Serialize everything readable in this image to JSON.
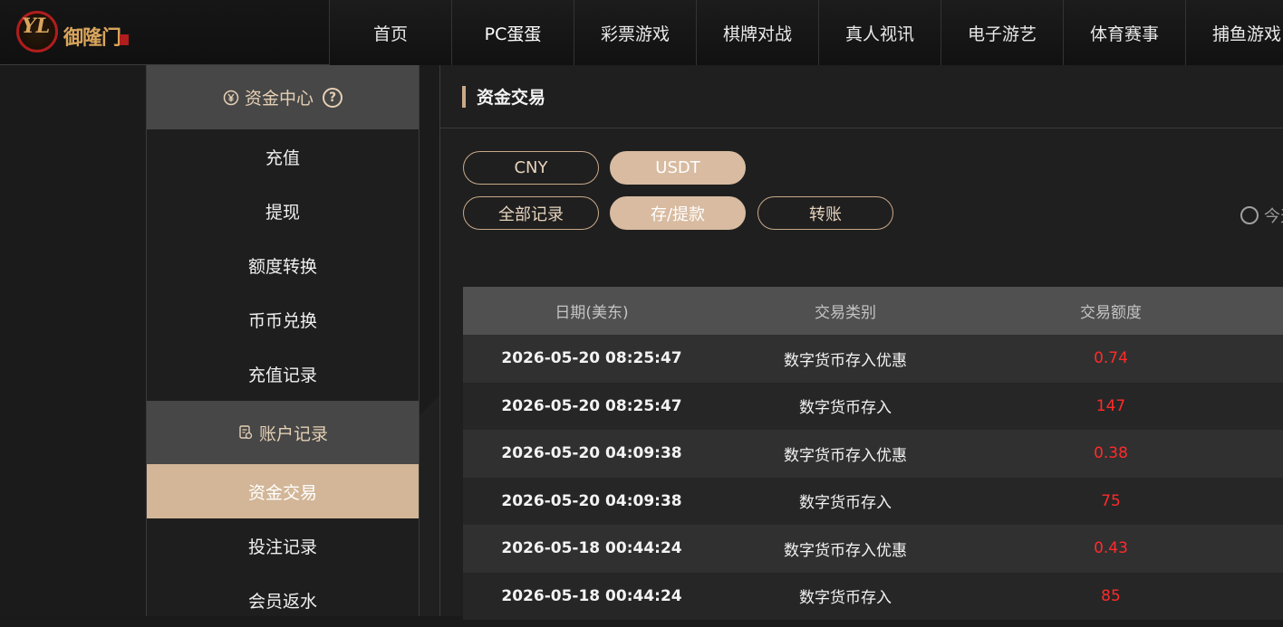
{
  "brand": {
    "logo_text": "御隆门"
  },
  "nav": {
    "items": [
      "首页",
      "PC蛋蛋",
      "彩票游戏",
      "棋牌对战",
      "真人视讯",
      "电子游艺",
      "体育赛事",
      "捕鱼游戏"
    ]
  },
  "sidebar": {
    "fund_center": "资金中心",
    "help_icon_text": "?",
    "fund_items": [
      "充值",
      "提现",
      "额度转换",
      "币币兑换",
      "充值记录"
    ],
    "account_records": "账户记录",
    "record_items": [
      "资金交易",
      "投注记录",
      "会员返水"
    ],
    "active_item": "资金交易"
  },
  "main": {
    "title": "资金交易",
    "currency_tabs": [
      "CNY",
      "USDT"
    ],
    "active_currency": "USDT",
    "record_tabs": [
      "全部记录",
      "存/提款",
      "转账"
    ],
    "active_record_tab": "存/提款",
    "date_radio_label": "今天"
  },
  "table": {
    "columns": [
      "日期(美东)",
      "交易类别",
      "交易额度"
    ],
    "rows": [
      {
        "date": "2026-05-20 08:25:47",
        "type": "数字货币存入优惠",
        "amount": "0.74"
      },
      {
        "date": "2026-05-20 08:25:47",
        "type": "数字货币存入",
        "amount": "147"
      },
      {
        "date": "2026-05-20 04:09:38",
        "type": "数字货币存入优惠",
        "amount": "0.38"
      },
      {
        "date": "2026-05-20 04:09:38",
        "type": "数字货币存入",
        "amount": "75"
      },
      {
        "date": "2026-05-18 00:44:24",
        "type": "数字货币存入优惠",
        "amount": "0.43"
      },
      {
        "date": "2026-05-18 00:44:24",
        "type": "数字货币存入",
        "amount": "85"
      }
    ]
  },
  "colors": {
    "accent": "#d2b697",
    "amount_red": "#ff2b2b",
    "header_gold": "#e5d0b5"
  }
}
